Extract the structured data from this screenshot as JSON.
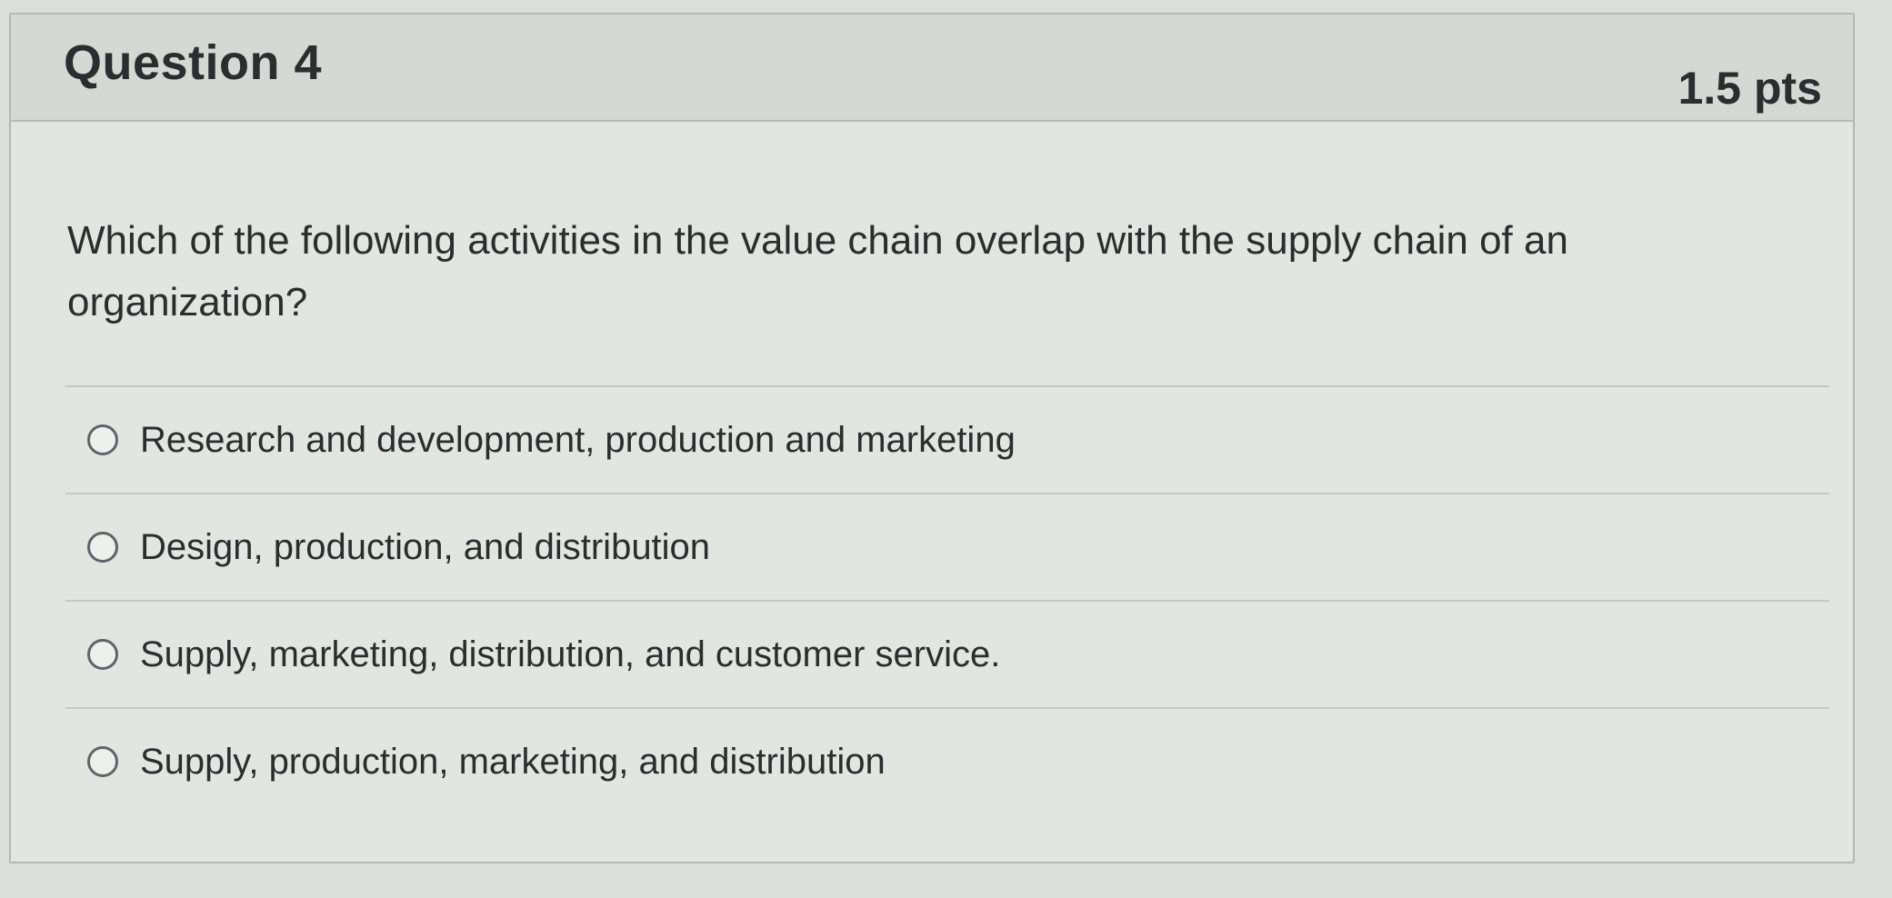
{
  "question": {
    "title": "Question 4",
    "points": "1.5 pts",
    "prompt": "Which of the following activities in the value chain overlap with the supply chain of an organization?",
    "answers": [
      {
        "label": "Research and development, production and marketing"
      },
      {
        "label": "Design, production, and distribution"
      },
      {
        "label": "Supply, marketing, distribution, and customer service."
      },
      {
        "label": "Supply, production, marketing, and distribution"
      }
    ]
  },
  "colors": {
    "card_background": "#e3e5e2",
    "header_background": "#d6d8d5",
    "text": "#2b2d2e",
    "border": "#b8bbb7"
  }
}
